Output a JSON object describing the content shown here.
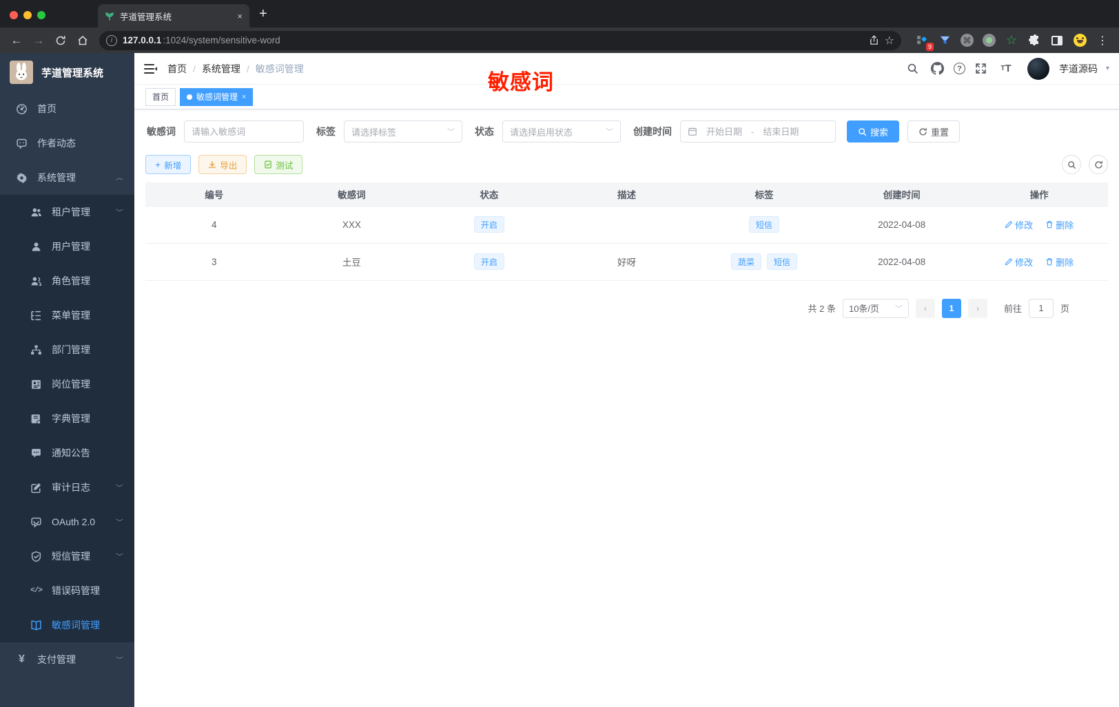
{
  "colors": {
    "primary": "#409eff",
    "sidebar_bg": "#2d3a4b",
    "submenu_bg": "#1f2d3d",
    "red_overlay": "#ff2000",
    "tag_bg": "#ecf5ff"
  },
  "browser": {
    "tab_title": "芋道管理系统",
    "close_tab": "×",
    "new_tab": "+",
    "url_host": "127.0.0.1",
    "url_rest": ":1024/system/sensitive-word",
    "extension_badge": "9",
    "command_glyph": "⌘",
    "star_glyph": "☆",
    "green_star_glyph": "☆",
    "kebab_glyph": "⋮",
    "back_glyph": "←",
    "forward_glyph": "→"
  },
  "overlay": {
    "red_text": "敏感词"
  },
  "sidebar": {
    "title": "芋道管理系统",
    "items": [
      {
        "label": "首页"
      },
      {
        "label": "作者动态"
      },
      {
        "label": "系统管理"
      },
      {
        "label": "租户管理"
      },
      {
        "label": "用户管理"
      },
      {
        "label": "角色管理"
      },
      {
        "label": "菜单管理"
      },
      {
        "label": "部门管理"
      },
      {
        "label": "岗位管理"
      },
      {
        "label": "字典管理"
      },
      {
        "label": "通知公告"
      },
      {
        "label": "审计日志"
      },
      {
        "label": "OAuth 2.0"
      },
      {
        "label": "短信管理"
      },
      {
        "label": "错误码管理"
      },
      {
        "label": "敏感词管理"
      },
      {
        "label": "支付管理"
      }
    ],
    "code_glyph": "</>",
    "yen_glyph": "¥",
    "chevron_up": "︿",
    "chevron_down": "﹀"
  },
  "header": {
    "breadcrumb": [
      "首页",
      "系统管理",
      "敏感词管理"
    ],
    "separator": "/",
    "username": "芋道源码",
    "caret": "▾",
    "help_glyph": "?"
  },
  "tabsview": {
    "home": "首页",
    "active": "敏感词管理",
    "close": "×"
  },
  "filters": {
    "keyword_label": "敏感词",
    "keyword_placeholder": "请输入敏感词",
    "tag_label": "标签",
    "tag_placeholder": "请选择标签",
    "status_label": "状态",
    "status_placeholder": "请选择启用状态",
    "date_label": "创建时间",
    "date_start_placeholder": "开始日期",
    "date_separator": "-",
    "date_end_placeholder": "结束日期",
    "search_label": "搜索",
    "reset_label": "重置",
    "select_arrow": "﹀"
  },
  "actions": {
    "add_label": "新增",
    "add_glyph": "+",
    "export_label": "导出",
    "test_label": "测试"
  },
  "table": {
    "columns": [
      "编号",
      "敏感词",
      "状态",
      "描述",
      "标签",
      "创建时间",
      "操作"
    ],
    "rows": [
      {
        "id": "4",
        "word": "XXX",
        "status": "开启",
        "desc": "",
        "tags": [
          "短信"
        ],
        "created": "2022-04-08",
        "edit": "修改",
        "delete": "删除"
      },
      {
        "id": "3",
        "word": "土豆",
        "status": "开启",
        "desc": "好呀",
        "tags": [
          "蔬菜",
          "短信"
        ],
        "created": "2022-04-08",
        "edit": "修改",
        "delete": "删除"
      }
    ]
  },
  "pagination": {
    "total": "共 2 条",
    "page_size": "10条/页",
    "prev_glyph": "‹",
    "page": "1",
    "next_glyph": "›",
    "goto_label": "前往",
    "goto_value": "1",
    "page_unit": "页",
    "select_arrow": "﹀"
  }
}
